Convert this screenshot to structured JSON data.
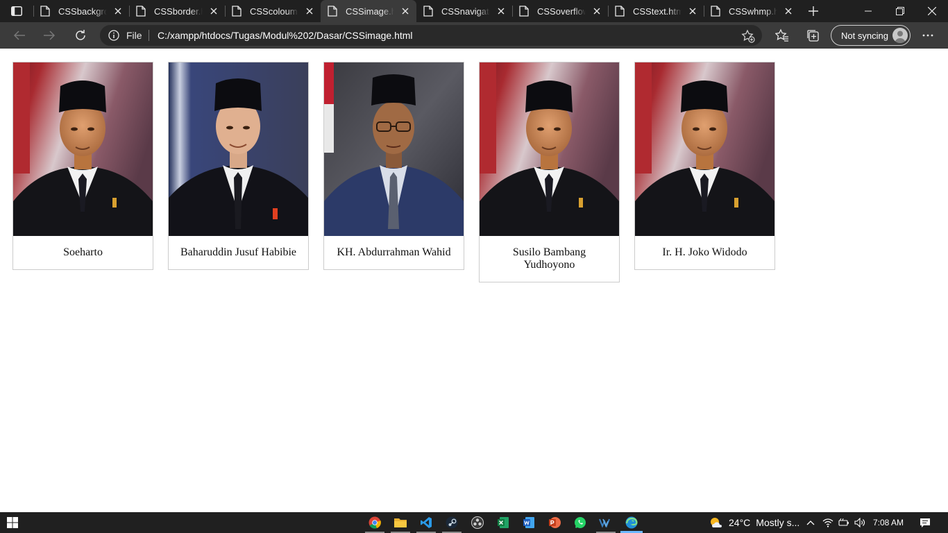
{
  "browser": {
    "tabs": [
      {
        "title": "CSSbackground.html",
        "active": false
      },
      {
        "title": "CSSborder.html",
        "active": false
      },
      {
        "title": "CSScoloum.html",
        "active": false
      },
      {
        "title": "CSSimage.html",
        "active": true
      },
      {
        "title": "CSSnavigation.html",
        "active": false
      },
      {
        "title": "CSSoverflow.html",
        "active": false
      },
      {
        "title": "CSStext.html",
        "active": false
      },
      {
        "title": "CSSwhmp.html",
        "active": false
      }
    ],
    "address_bar": {
      "scheme_label": "File",
      "url": "C:/xampp/htdocs/Tugas/Modul%202/Dasar/CSSimage.html"
    },
    "profile": {
      "sync_label": "Not syncing"
    }
  },
  "gallery": [
    {
      "caption": "Soeharto",
      "portrait": "soeharto"
    },
    {
      "caption": "Baharuddin Jusuf Habibie",
      "portrait": "habibie"
    },
    {
      "caption": "KH. Abdurrahman Wahid",
      "portrait": "wahid"
    },
    {
      "caption": "Susilo Bambang Yudhoyono",
      "portrait": "soeharto"
    },
    {
      "caption": "Ir. H. Joko Widodo",
      "portrait": "soeharto"
    }
  ],
  "taskbar": {
    "apps": [
      "chrome-icon",
      "file-explorer-icon",
      "vscode-icon",
      "steam-icon",
      "obs-icon",
      "excel-icon",
      "word-icon",
      "powerpoint-icon",
      "whatsapp-icon",
      "vmware-icon",
      "edge-icon"
    ],
    "weather": {
      "temperature": "24°C",
      "condition": "Mostly s..."
    },
    "time": "7:08 AM"
  },
  "colors": {
    "titlebar": "#202020",
    "toolbar": "#3b3b3b",
    "address_field": "#292929",
    "card_border": "#cccccc"
  }
}
